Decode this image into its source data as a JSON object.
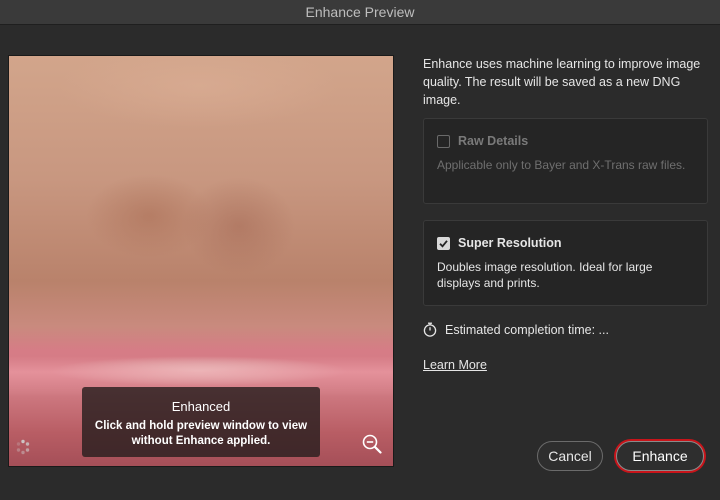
{
  "window": {
    "title": "Enhance Preview"
  },
  "preview": {
    "overlay_title": "Enhanced",
    "overlay_text": "Click and hold preview window to view without Enhance applied."
  },
  "description": "Enhance uses machine learning to improve image quality. The result will be saved as a new DNG image.",
  "options": {
    "raw_details": {
      "label": "Raw Details",
      "checked": false,
      "enabled": false,
      "text": "Applicable only to Bayer and X-Trans raw files."
    },
    "super_resolution": {
      "label": "Super Resolution",
      "checked": true,
      "enabled": true,
      "text": "Doubles image resolution. Ideal for large displays and prints."
    }
  },
  "estimated": {
    "label": "Estimated completion time: ..."
  },
  "learn_more": "Learn More",
  "buttons": {
    "cancel": "Cancel",
    "enhance": "Enhance"
  },
  "icons": {
    "timer": "stopwatch-icon",
    "zoom": "zoom-out-icon",
    "spinner": "loading-spinner-icon",
    "check": "checkmark-icon"
  },
  "colors": {
    "highlight": "#c8141a",
    "background": "#2b2b2b",
    "panel": "#252525"
  }
}
